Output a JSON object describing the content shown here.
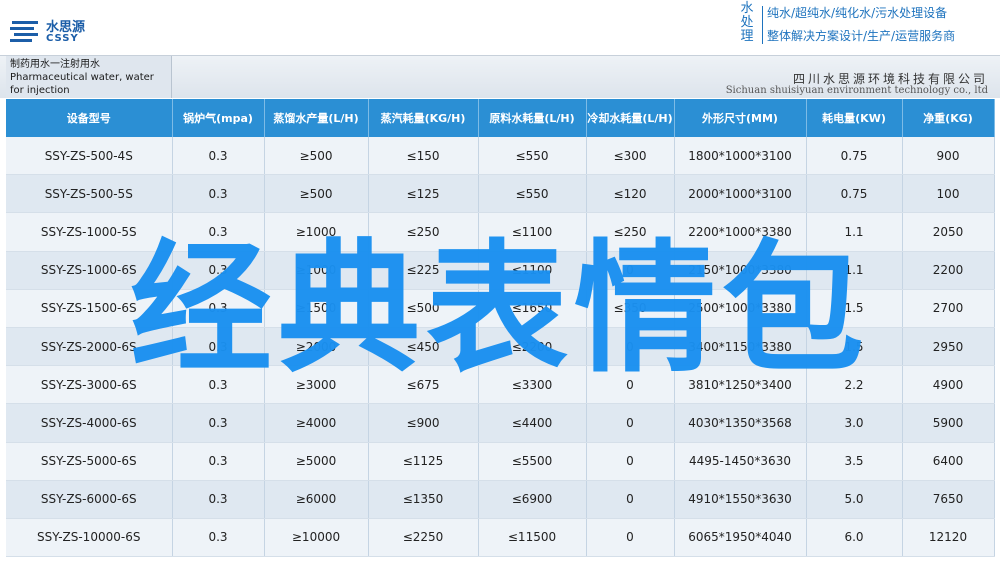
{
  "brand": {
    "name_cn": "水思源",
    "name_en": "CSSY",
    "vertical_label": "水处理",
    "slogan_line1": "纯水/超纯水/纯化水/污水处理设备",
    "slogan_line2": "整体解决方案设计/生产/运营服务商"
  },
  "title": {
    "cn": "制药用水一注射用水",
    "en": "Pharmaceutical water, water for injection"
  },
  "company": {
    "cn": "四川水思源环境科技有限公司",
    "en": "Sichuan shuisiyuan environment technology co., ltd"
  },
  "table": {
    "headers": [
      "设备型号",
      "锅炉气(mpa)",
      "蒸馏水产量(L/H)",
      "蒸汽耗量(KG/H)",
      "原料水耗量(L/H)",
      "冷却水耗量(L/H)",
      "外形尺寸(MM)",
      "耗电量(KW)",
      "净重(KG)"
    ],
    "rows": [
      [
        "SSY-ZS-500-4S",
        "0.3",
        "≥500",
        "≤150",
        "≤550",
        "≤300",
        "1800*1000*3100",
        "0.75",
        "900"
      ],
      [
        "SSY-ZS-500-5S",
        "0.3",
        "≥500",
        "≤125",
        "≤550",
        "≤120",
        "2000*1000*3100",
        "0.75",
        "100"
      ],
      [
        "SSY-ZS-1000-5S",
        "0.3",
        "≥1000",
        "≤250",
        "≤1100",
        "≤250",
        "2200*1000*3380",
        "1.1",
        "2050"
      ],
      [
        "SSY-ZS-1000-6S",
        "0.3",
        "≥1000",
        "≤225",
        "≤1100",
        "0",
        "2150*1000*3380",
        "1.1",
        "2200"
      ],
      [
        "SSY-ZS-1500-6S",
        "0.3",
        "≥1500",
        "≤500",
        "≤1650",
        "≤350",
        "2500*1000*3380",
        "1.5",
        "2700"
      ],
      [
        "SSY-ZS-2000-6S",
        "0.3",
        "≥2000",
        "≤450",
        "≤2200",
        "0",
        "3400*1150*3380",
        "1.5",
        "2950"
      ],
      [
        "SSY-ZS-3000-6S",
        "0.3",
        "≥3000",
        "≤675",
        "≤3300",
        "0",
        "3810*1250*3400",
        "2.2",
        "4900"
      ],
      [
        "SSY-ZS-4000-6S",
        "0.3",
        "≥4000",
        "≤900",
        "≤4400",
        "0",
        "4030*1350*3568",
        "3.0",
        "5900"
      ],
      [
        "SSY-ZS-5000-6S",
        "0.3",
        "≥5000",
        "≤1125",
        "≤5500",
        "0",
        "4495-1450*3630",
        "3.5",
        "6400"
      ],
      [
        "SSY-ZS-6000-6S",
        "0.3",
        "≥6000",
        "≤1350",
        "≤6900",
        "0",
        "4910*1550*3630",
        "5.0",
        "7650"
      ],
      [
        "SSY-ZS-10000-6S",
        "0.3",
        "≥10000",
        "≤2250",
        "≤11500",
        "0",
        "6065*1950*4040",
        "6.0",
        "12120"
      ]
    ]
  },
  "overlay_text": "经典表情包",
  "colors": {
    "brand_blue": "#1c5ea8",
    "header_blue": "#2b8fd4",
    "overlay_blue": "#1a90f0"
  }
}
